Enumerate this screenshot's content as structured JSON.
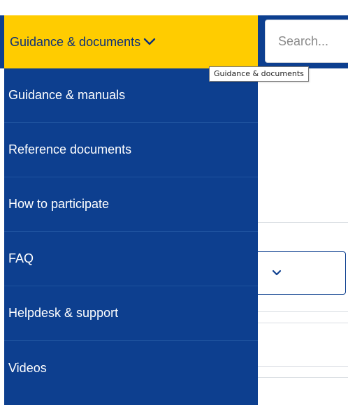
{
  "nav": {
    "trigger_label": "Guidance & documents",
    "tooltip": "Guidance & documents",
    "colors": {
      "accent": "#ffcc00",
      "primary": "#0d3f8f"
    }
  },
  "search": {
    "placeholder": "Search..."
  },
  "menu": {
    "items": [
      {
        "label": "Guidance & manuals"
      },
      {
        "label": "Reference documents"
      },
      {
        "label": "How to participate"
      },
      {
        "label": "FAQ"
      },
      {
        "label": "Helpdesk & support"
      },
      {
        "label": "Videos"
      }
    ]
  }
}
